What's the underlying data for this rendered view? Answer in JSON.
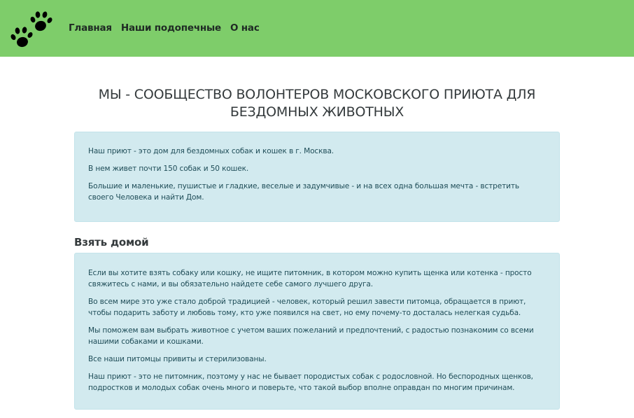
{
  "nav": {
    "logo_icon": "paw-prints-icon",
    "links": [
      "Главная",
      "Наши подопечные",
      "О нас"
    ]
  },
  "colors": {
    "navbar": "#7ecd6a",
    "info_box": "#d2eaef",
    "info_text": "#1f4d58"
  },
  "page": {
    "title": "МЫ - СООБЩЕСТВО ВОЛОНТЕРОВ МОСКОВСКОГО ПРИЮТА ДЛЯ БЕЗДОМНЫХ ЖИВОТНЫХ",
    "intro": [
      "Наш приют - это дом для бездомных собак и кошек в г. Москва.",
      "В нем живет почти 150 собак и 50 кошек.",
      "Большие и маленькие, пушистые и гладкие, веселые и задумчивые - и на всех одна большая мечта - встретить своего Человека и найти Дом."
    ],
    "adopt": {
      "title": "Взять домой",
      "paragraphs": [
        "Если вы хотите взять собаку или кошку, не ищите питомник, в котором можно купить щенка или котенка - просто свяжитесь с нами, и вы обязательно найдете себе самого лучшего друга.",
        "Во всем мире это уже стало доброй традицией - человек, который решил завести питомца, обращается в приют, чтобы подарить заботу и любовь тому, кто уже появился на свет, но ему почему-то досталась нелегкая судьба.",
        "Мы поможем вам выбрать животное с учетом ваших пожеланий и предпочтений, с радостью познакомим со всеми нашими собаками и кошками.",
        "Все наши питомцы привиты и стерилизованы.",
        "Наш приют - это не питомник, поэтому у нас не бывает породистых собак с родословной. Но беспородных щенков, подростков и молодых собак очень много и поверьте, что такой выбор вполне оправдан по многим причинам."
      ]
    }
  }
}
